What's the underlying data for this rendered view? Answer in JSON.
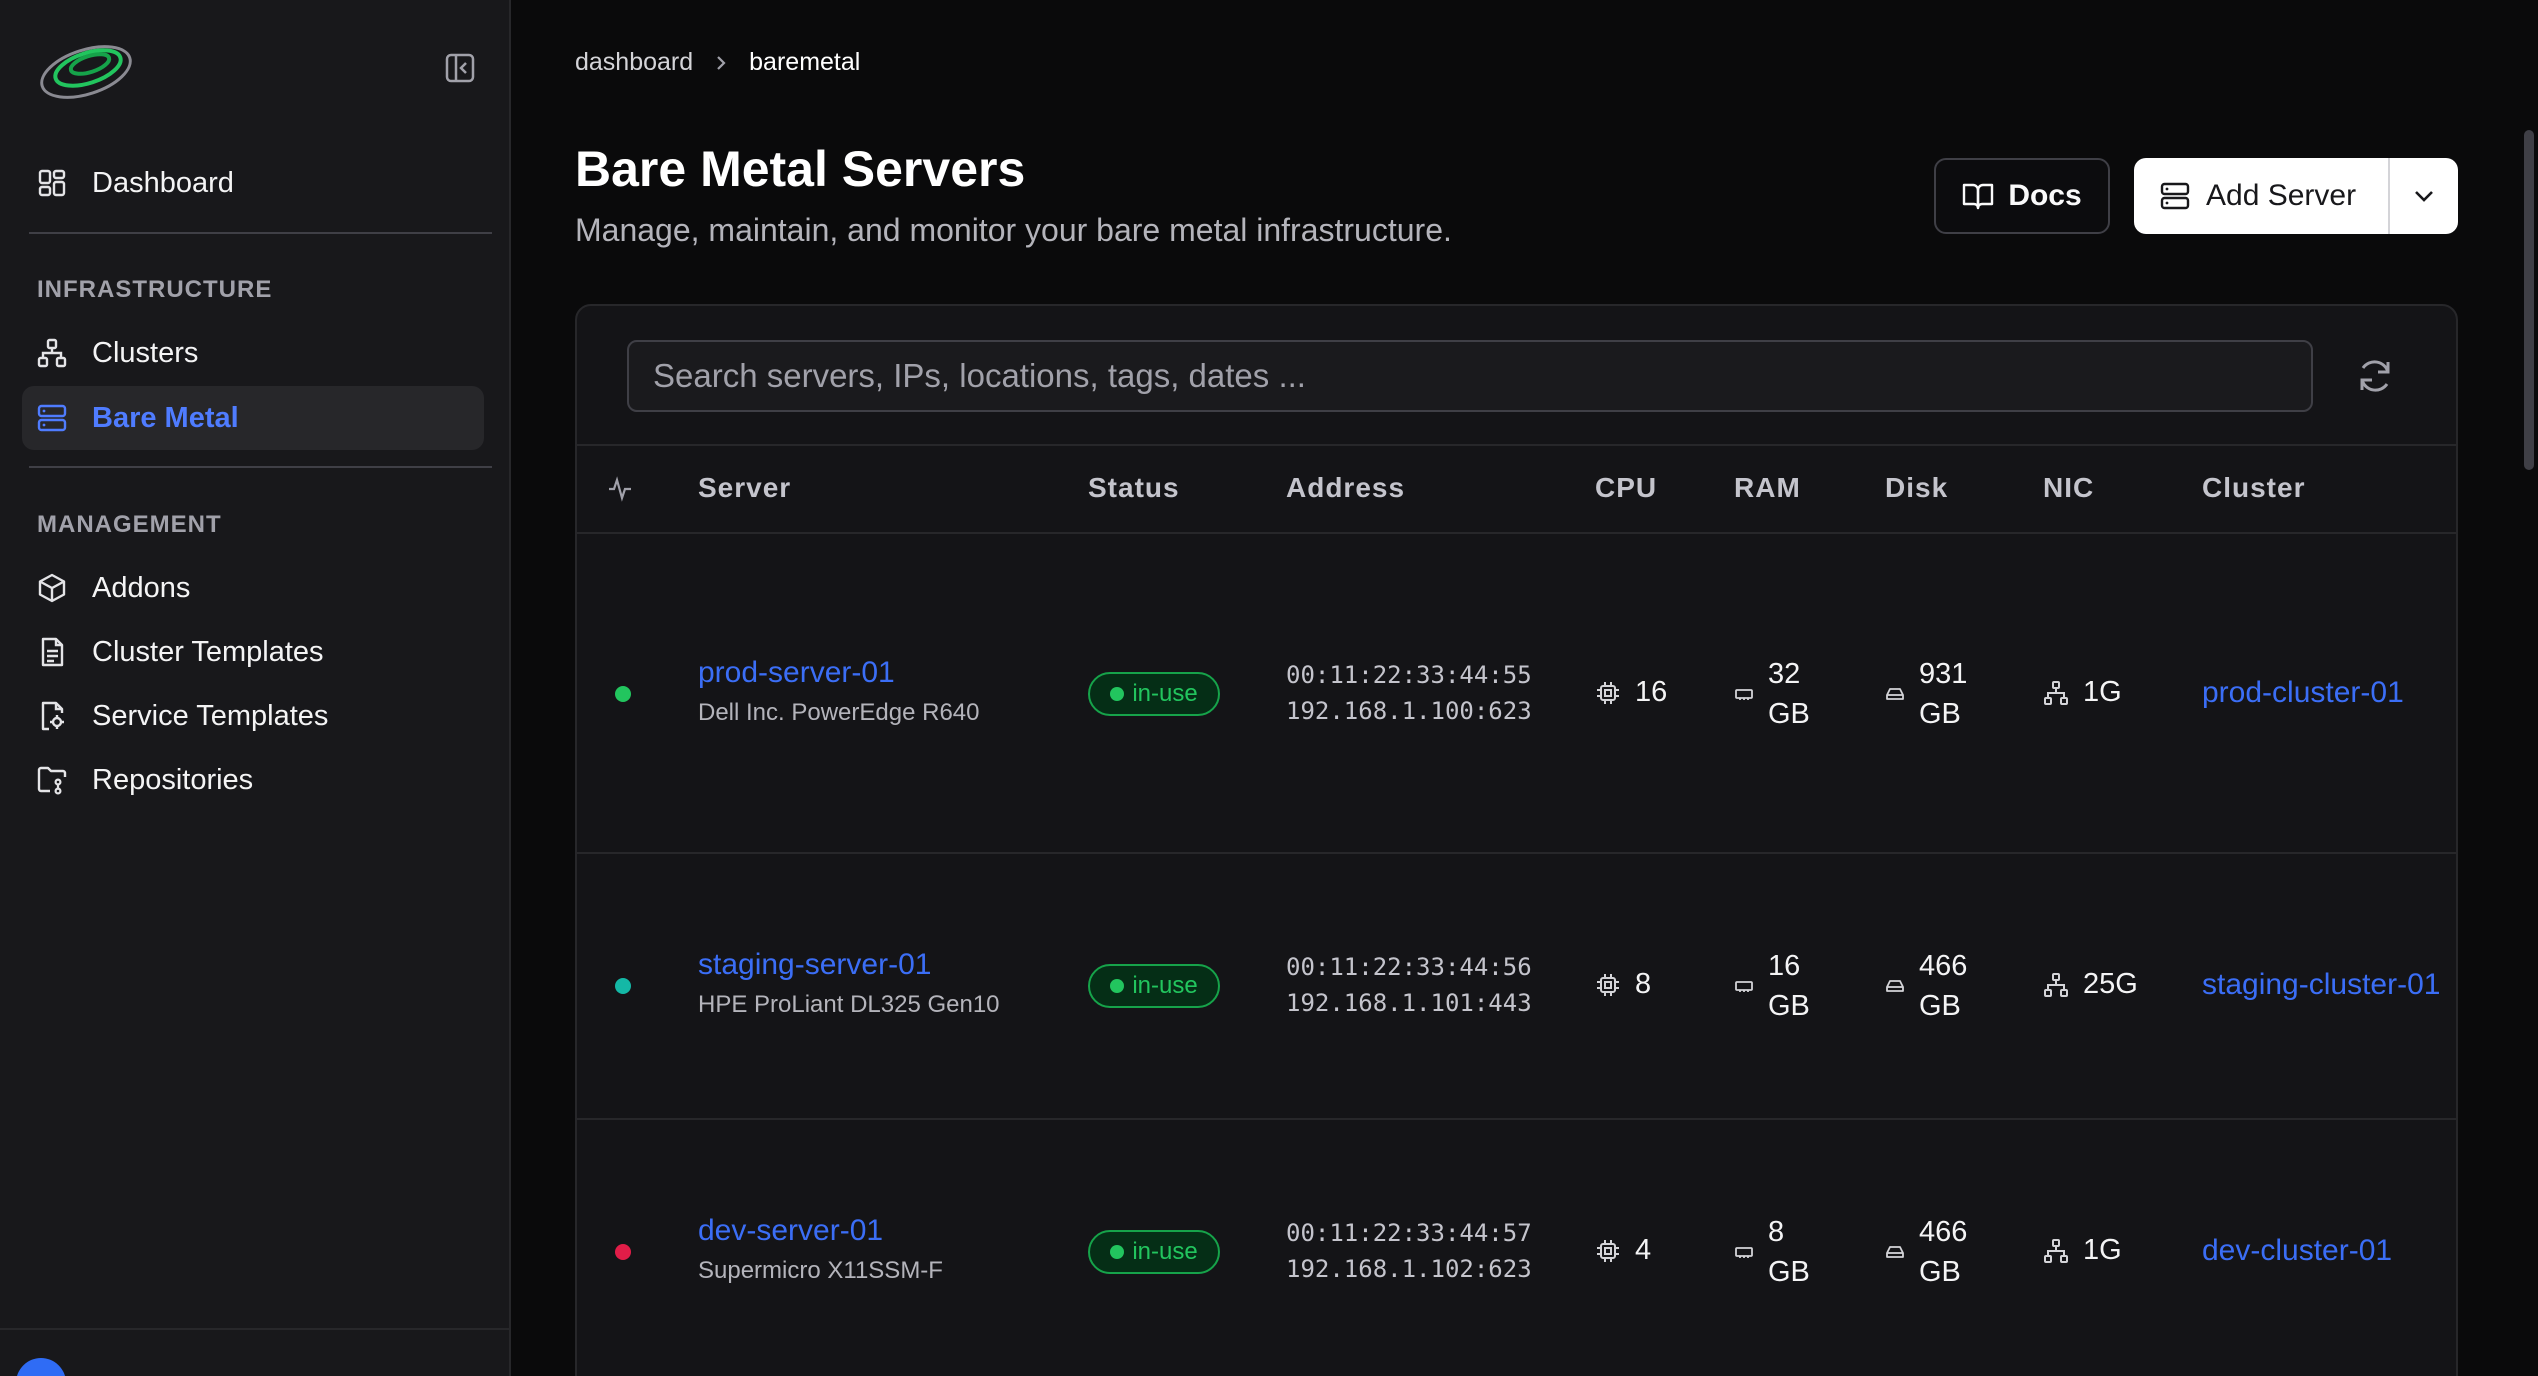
{
  "sidebar": {
    "dashboard_label": "Dashboard",
    "infrastructure_heading": "INFRASTRUCTURE",
    "clusters_label": "Clusters",
    "baremetal_label": "Bare Metal",
    "management_heading": "MANAGEMENT",
    "addons_label": "Addons",
    "cluster_templates_label": "Cluster Templates",
    "service_templates_label": "Service Templates",
    "repositories_label": "Repositories"
  },
  "breadcrumb": {
    "root": "dashboard",
    "current": "baremetal"
  },
  "header": {
    "title": "Bare Metal Servers",
    "subtitle": "Manage, maintain, and monitor your bare metal infrastructure.",
    "docs_label": "Docs",
    "add_label": "Add Server"
  },
  "search": {
    "placeholder": "Search servers, IPs, locations, tags, dates ..."
  },
  "table": {
    "columns": [
      "Server",
      "Status",
      "Address",
      "CPU",
      "RAM",
      "Disk",
      "NIC",
      "Cluster"
    ],
    "rows": [
      {
        "name": "prod-server-01",
        "model": "Dell Inc. PowerEdge R640",
        "status": "in-use",
        "mac": "00:11:22:33:44:55",
        "ip": "192.168.1.100:623",
        "cpu": "16",
        "ram_val": "32",
        "ram_unit": "GB",
        "disk_val": "931",
        "disk_unit": "GB",
        "nic": "1G",
        "cluster": "prod-cluster-01",
        "health_color": "#22c55e"
      },
      {
        "name": "staging-server-01",
        "model": "HPE ProLiant DL325 Gen10",
        "status": "in-use",
        "mac": "00:11:22:33:44:56",
        "ip": "192.168.1.101:443",
        "cpu": "8",
        "ram_val": "16",
        "ram_unit": "GB",
        "disk_val": "466",
        "disk_unit": "GB",
        "nic": "25G",
        "cluster": "staging-cluster-01",
        "health_color": "#14b8a6"
      },
      {
        "name": "dev-server-01",
        "model": "Supermicro X11SSM-F",
        "status": "in-use",
        "mac": "00:11:22:33:44:57",
        "ip": "192.168.1.102:623",
        "cpu": "4",
        "ram_val": "8",
        "ram_unit": "GB",
        "disk_val": "466",
        "disk_unit": "GB",
        "nic": "1G",
        "cluster": "dev-cluster-01",
        "health_color": "#e11d48"
      }
    ]
  },
  "colors": {
    "accent": "#3b6ef6",
    "status_ok": "#22c55e"
  }
}
